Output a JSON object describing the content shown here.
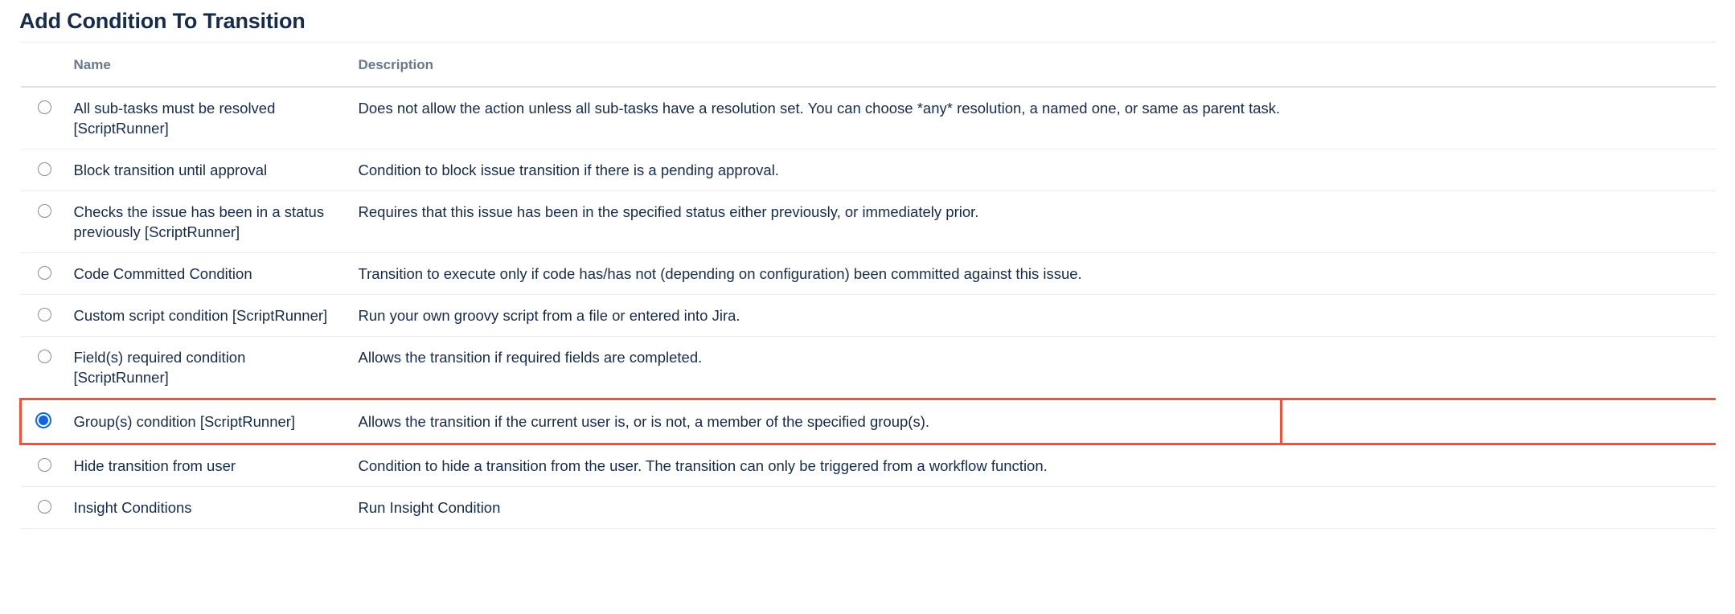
{
  "page": {
    "title": "Add Condition To Transition"
  },
  "table": {
    "columns": {
      "radio": "",
      "name": "Name",
      "description": "Description"
    },
    "rows": [
      {
        "name": "All sub-tasks must be resolved [ScriptRunner]",
        "description": "Does not allow the action unless all sub-tasks have a resolution set. You can choose *any* resolution, a named one, or same as parent task.",
        "selected": false,
        "highlighted": false
      },
      {
        "name": "Block transition until approval",
        "description": "Condition to block issue transition if there is a pending approval.",
        "selected": false,
        "highlighted": false
      },
      {
        "name": "Checks the issue has been in a status previously [ScriptRunner]",
        "description": "Requires that this issue has been in the specified status either previously, or immediately prior.",
        "selected": false,
        "highlighted": false
      },
      {
        "name": "Code Committed Condition",
        "description": "Transition to execute only if code has/has not (depending on configuration) been committed against this issue.",
        "selected": false,
        "highlighted": false
      },
      {
        "name": "Custom script condition [ScriptRunner]",
        "description": "Run your own groovy script from a file or entered into Jira.",
        "selected": false,
        "highlighted": false
      },
      {
        "name": "Field(s) required condition [ScriptRunner]",
        "description": "Allows the transition if required fields are completed.",
        "selected": false,
        "highlighted": false
      },
      {
        "name": "Group(s) condition [ScriptRunner]",
        "description": "Allows the transition if the current user is, or is not, a member of the specified group(s).",
        "selected": true,
        "highlighted": true
      },
      {
        "name": "Hide transition from user",
        "description": "Condition to hide a transition from the user. The transition can only be triggered from a workflow function.",
        "selected": false,
        "highlighted": false
      },
      {
        "name": "Insight Conditions",
        "description": "Run Insight Condition",
        "selected": false,
        "highlighted": false
      }
    ]
  },
  "colors": {
    "text": "#172b4d",
    "header_text": "#6b778c",
    "radio_selected": "#0c66e4",
    "annotation_border": "#fb4f35",
    "row_divider": "#ebecf0"
  }
}
